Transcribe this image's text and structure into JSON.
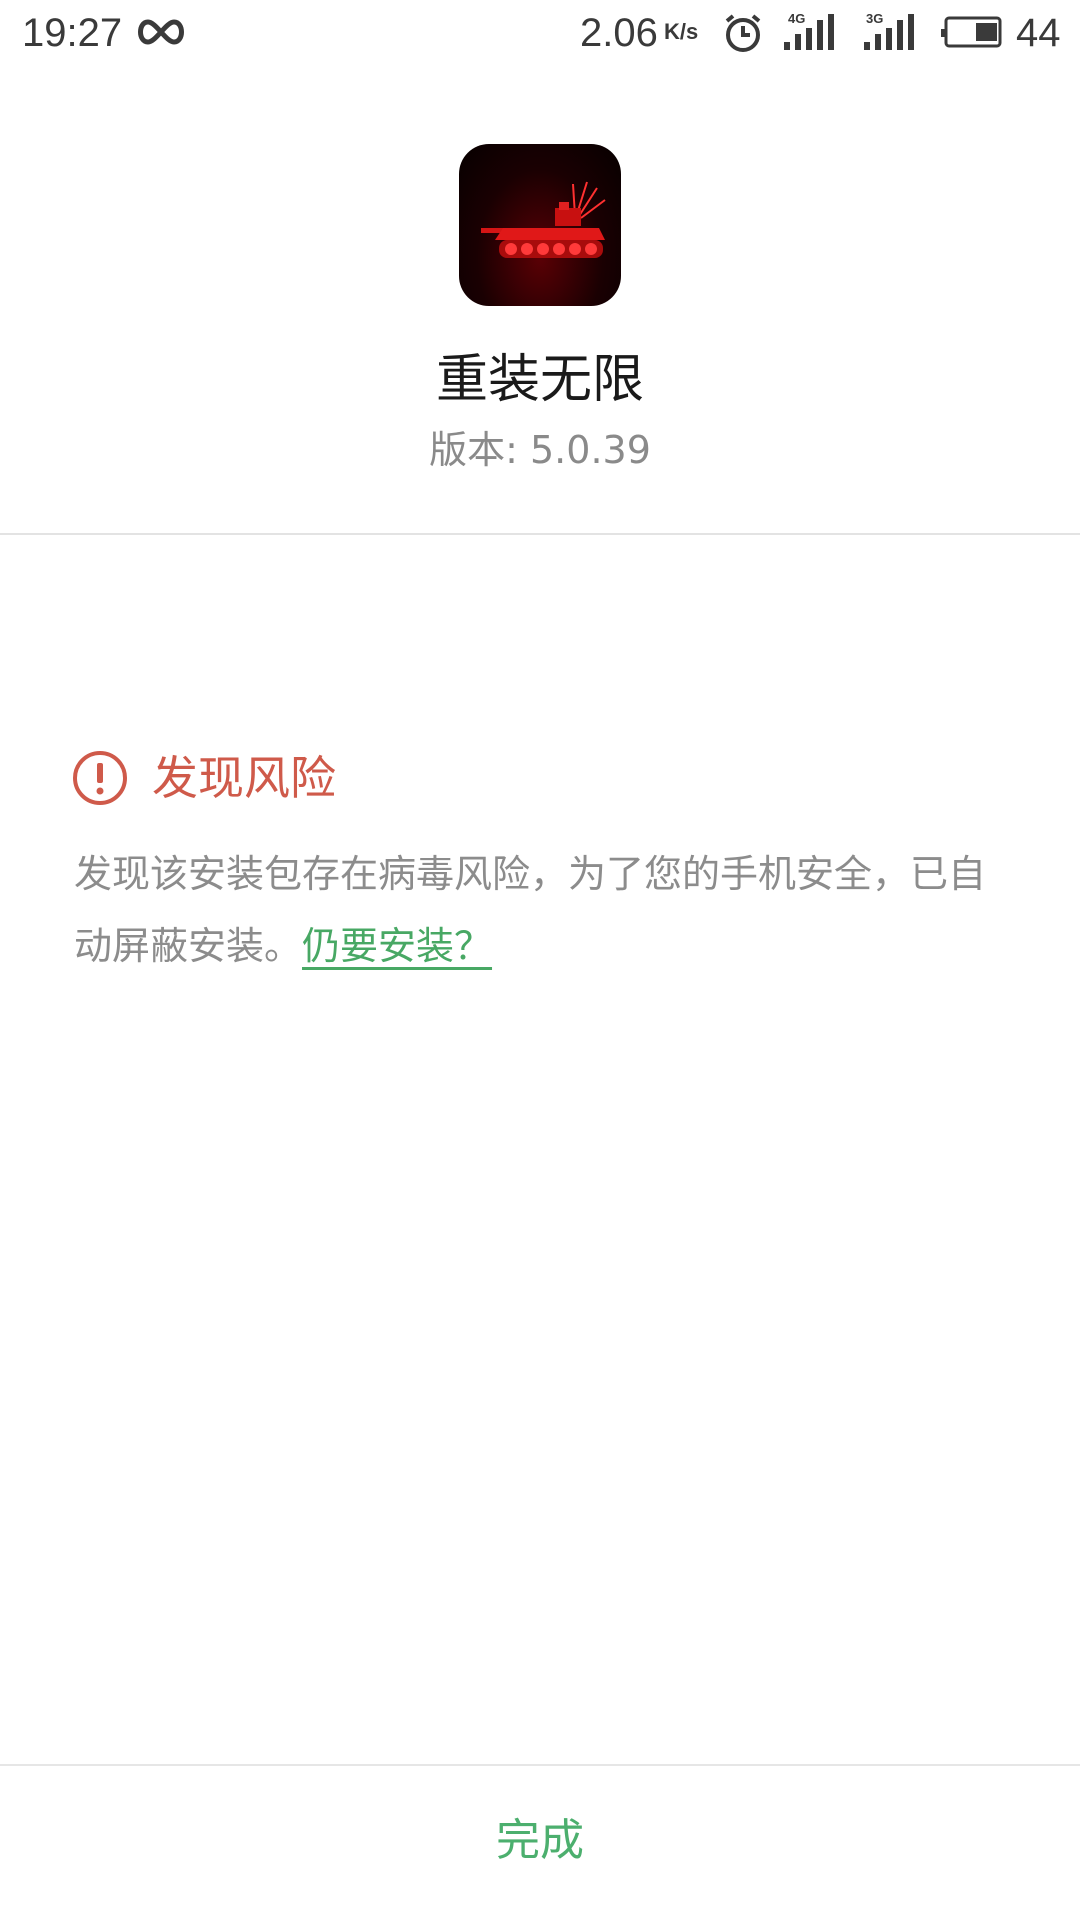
{
  "status_bar": {
    "time": "19:27",
    "net_speed": "2.06",
    "net_speed_unit": "K/s",
    "signal_1_type": "4G",
    "signal_2_type": "3G",
    "battery_percent": "44",
    "battery_level": 0.44
  },
  "app": {
    "name": "重装无限",
    "version_label": "版本: 5.0.39",
    "icon": "tank-game-icon"
  },
  "risk": {
    "title": "发现风险",
    "message": "发现该安装包存在病毒风险，为了您的手机安全，已自动屏蔽安装。",
    "link_label": "仍要安装？",
    "icon": "warning-circle-icon"
  },
  "footer": {
    "done_label": "完成"
  },
  "colors": {
    "risk_red": "#cf5a4a",
    "accent_green": "#4caf6e",
    "text_gray": "#8c8c8c"
  }
}
